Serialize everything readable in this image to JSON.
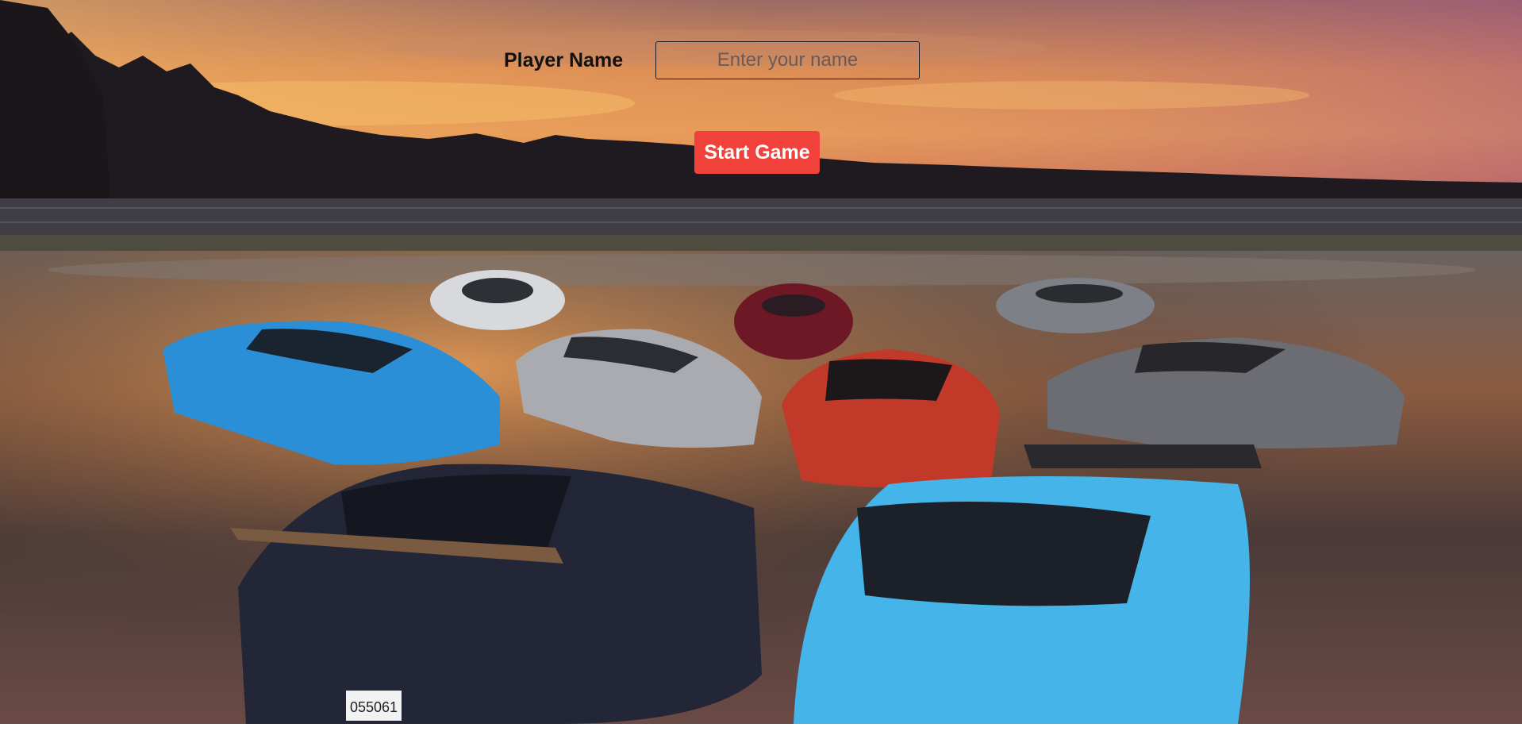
{
  "form": {
    "player_label": "Player Name",
    "name_placeholder": "Enter your name",
    "name_value": "",
    "start_label": "Start Game"
  },
  "background": {
    "accent": "#f0413a",
    "license_plate_text": "055061"
  }
}
